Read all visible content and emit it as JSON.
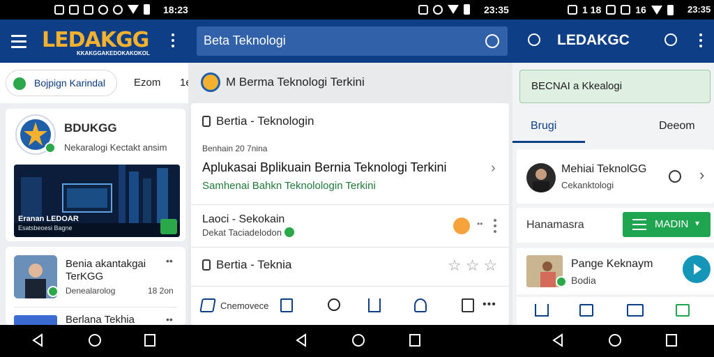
{
  "status": {
    "time1": "18:23",
    "time2": "23:35",
    "time3_prefix": "1 18",
    "time3_mid": "16",
    "time3": "23:35"
  },
  "panel1": {
    "logo": "LEDAKGG",
    "logo_sub": "KKAKGGAKEDOKAKOKOL",
    "chip_label": "Bojpign Karindal",
    "chip_right": "Ezom",
    "chip_far": "1e",
    "profile_title": "BDUKGG",
    "profile_subtitle": "Nekaralogi Kectakt ansim",
    "banner_caption_line1": "Eranan LEDOAR",
    "banner_caption_line2": "Esatsbeoesi Bagne",
    "item1_title_line1": "Benia akantakgai",
    "item1_title_line2": "TerKGG",
    "item1_source": "Denealarolog",
    "item1_time": "18 2on",
    "item2_title": "Berlana Tekhia"
  },
  "panel2": {
    "search_text": "Beta Teknologi",
    "header_title": "M Berma Teknologi Terkini",
    "section_title": "Bertia - Teknologin",
    "meta": "Benhain 20 7nina",
    "headline": "Aplukasai Bplikuain Bernia Teknologi Terkini",
    "subheadline": "Samhenai Bahkn Teknolologin Terkini",
    "row2_title": "Laoci - Sekokain",
    "row2_sub": "Dekat Taciadelodon",
    "row3_title": "Bertia - Teknia",
    "bottom_label": "Cnemovece"
  },
  "panel3": {
    "title": "LEDAKGC",
    "banner_text": "BECNAI a Kkealogi",
    "tab1": "Brugi",
    "tab2": "Deeom",
    "profile_name": "Mehiai TeknolGG",
    "profile_sub": "Cekanktologi",
    "menu_label": "Hanamasra",
    "madin_label": "MADIN",
    "media_title": "Pange Keknaym",
    "media_sub": "Bodia"
  },
  "colors": {
    "appbar": "#0e3f86",
    "search": "#3161a9",
    "accent_green": "#1fa550",
    "link_green": "#1f7a3a",
    "teal": "#1596b8",
    "orange": "#f5a33a"
  },
  "icons": [
    "hamburger-icon",
    "kebab-icon",
    "search-icon",
    "bulb-icon",
    "star-icon",
    "home-icon",
    "back-icon",
    "recents-icon"
  ]
}
